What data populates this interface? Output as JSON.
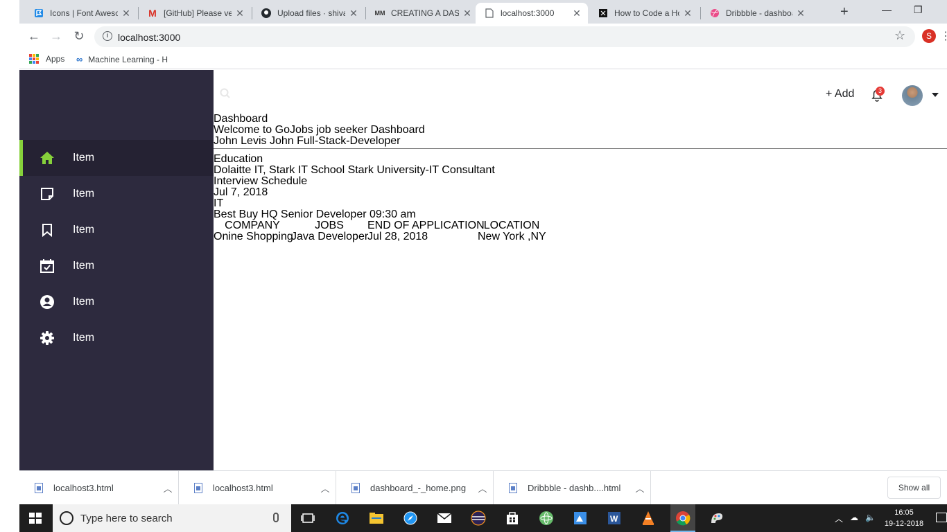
{
  "browser": {
    "tabs": [
      {
        "title": "Icons | Font Awesome",
        "icon": "font-awesome-icon",
        "active": false
      },
      {
        "title": "[GitHub] Please verify",
        "icon": "gmail-icon",
        "active": false
      },
      {
        "title": "Upload files · shiva",
        "icon": "github-icon",
        "active": false
      },
      {
        "title": "CREATING A DASH",
        "icon": "mm-icon",
        "active": false
      },
      {
        "title": "localhost:3000",
        "icon": "page-icon",
        "active": true
      },
      {
        "title": "How to Code a Home",
        "icon": "codepen-icon",
        "active": false
      },
      {
        "title": "Dribbble - dashboard",
        "icon": "dribbble-icon",
        "active": false
      }
    ],
    "url": "localhost:3000",
    "profile_initial": "S",
    "bookmarks": [
      {
        "label": "Apps",
        "icon": "apps-grid-icon"
      },
      {
        "label": "Machine Learning - H",
        "icon": "coursera-icon"
      }
    ]
  },
  "sidebar": {
    "items": [
      {
        "label": "Item",
        "icon": "home-icon",
        "active": true
      },
      {
        "label": "Item",
        "icon": "note-icon",
        "active": false
      },
      {
        "label": "Item",
        "icon": "bookmark-icon",
        "active": false
      },
      {
        "label": "Item",
        "icon": "calendar-check-icon",
        "active": false
      },
      {
        "label": "Item",
        "icon": "user-circle-icon",
        "active": false
      },
      {
        "label": "Item",
        "icon": "gear-icon",
        "active": false
      }
    ]
  },
  "header": {
    "add_label": "+ Add",
    "notification_count": "3"
  },
  "dashboard": {
    "title": "Dashboard",
    "welcome": "Welcome to GoJobs job seeker Dashboard",
    "profile_line": "John Levis John Full-Stack-Developer",
    "education_heading": "Education",
    "education_detail": "Dolaitte IT, Stark IT School Stark University-IT Consultant",
    "interview_heading": "Interview Schedule",
    "interview_date": "Jul 7, 2018",
    "interview_category": "IT",
    "interview_detail": "Best Buy HQ Senior Developer 09:30 am",
    "table": {
      "headers": [
        "COMPANY",
        "JOBS",
        "END OF APPLICATION",
        "LOCATION"
      ],
      "rows": [
        [
          "Onine Shopping",
          "Java Developer",
          "Jul 28, 2018",
          "New York ,NY"
        ]
      ]
    }
  },
  "downloads": {
    "items": [
      "localhost3.html",
      "localhost3.html",
      "dashboard_-_home.png",
      "Dribbble - dashb....html"
    ],
    "show_all_label": "Show all"
  },
  "taskbar": {
    "search_placeholder": "Type here to search",
    "time": "16:05",
    "date": "19-12-2018"
  },
  "colors": {
    "sidebar_bg": "#2d2a3e",
    "sidebar_active_bg": "#252233",
    "accent_green": "#86d13b",
    "badge_red": "#e53935"
  }
}
